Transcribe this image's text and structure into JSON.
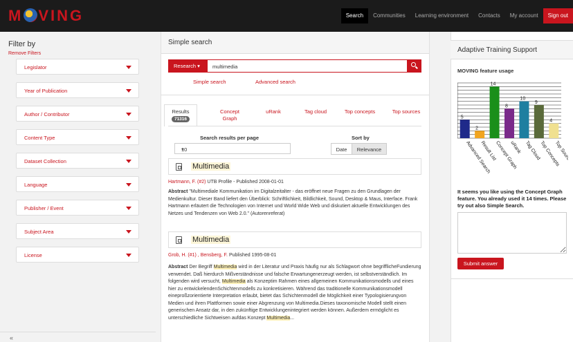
{
  "app": {
    "logo_text_left": "M",
    "logo_text_right": "VING"
  },
  "nav": {
    "items": [
      "Search",
      "Communities",
      "Learning environment",
      "Contacts",
      "My account"
    ],
    "signout": "Sign out"
  },
  "sidebar": {
    "title": "Filter by",
    "remove": "Remove Filters",
    "filters": [
      "Legislator",
      "Year of Publication",
      "Author / Contributor",
      "Content Type",
      "Dataset Collection",
      "Language",
      "Publisher / Event",
      "Subject Area",
      "License"
    ]
  },
  "search": {
    "header": "Simple search",
    "mode": "Research ▾",
    "query": "multimedia",
    "simple_link": "Simple search",
    "advanced_link": "Advanced search"
  },
  "tabs": {
    "results": "Results",
    "results_count": "71316",
    "concept_1": "Concept",
    "concept_2": "Graph",
    "urank": "uRank",
    "tagcloud": "Tag cloud",
    "topconcepts": "Top concepts",
    "topsources": "Top sources"
  },
  "controls": {
    "per_page_label": "Search results per page",
    "per_page_value": "10",
    "sort_label": "Sort by",
    "sort_date": "Date",
    "sort_relevance": "Relevance"
  },
  "results": [
    {
      "title": "Multimedia",
      "author": "Hartmann, F. (#2)",
      "meta": " UTB Profile - Published 2008-01-01",
      "abstract_label": "Abstract",
      "abstract": "\"Multimediale Kommunikation im Digitalzeitalter - das eröffnet neue Fragen zu den Grundlagen der Medienkultur. Dieser Band liefert den Überblick: Schriftlichkeit, Bildlichkeit, Sound, Desktop & Maus, Interface. Frank Hartmann erläutert die Technologien von Internet und World Wide Web und diskutiert aktuelle Entwicklungen des Netzes und Tendenzen von Web 2.0.\" (Autorenreferat)"
    },
    {
      "title": "Multimedia",
      "author": "Grob, H. (#1)",
      "author2": " , Bensberg, F.",
      "meta": " Published 1995-08-01",
      "abstract_label": "Abstract",
      "abstract_a": " Der Begriff ",
      "hl1": "Multimedia",
      "abstract_b": " wird in der Literatur und Praxis häufig nur als Schlagwort ohne begrifflicheFundierung verwendet. Daß hierdurch Mißverständnisse und falsche Erwartungenerzeugt werden, ist selbstverständlich. Im folgenden wird versucht, ",
      "hl2": "Multimedia",
      "abstract_c": " als Konzeptim Rahmen eines allgemeinen Kommunikationsmodells und eines hier zu entwickelendenSchichtenmodells zu konkretisieren. Während das traditionelle Kommunikationsmodell eineproßzorientierte Interpretation erlaubt, bietet das Schichtenmodell die Möglichkeit einer Typologisierungvon Medien und ihren Plattformen sowie einer Abgrenzung von Multimedia.Dieses taxonomische Modell stellt einen generischen Ansatz dar, in den zukünftige Entwicklungenintegriert werden können. Außerdem ermöglicht es unterschiedliche Sichtweisen aufdas Konzept ",
      "hl3": "Multimedia",
      "abstract_d": "..."
    }
  ],
  "ats": {
    "header": "Adaptive Training Support",
    "chart_title": "MOVING feature usage",
    "hint": "It seems you like using the Concept Graph feature. You already used it 14 times. Please try out also Simple Search.",
    "submit": "Submit answer"
  },
  "chart_data": {
    "type": "bar",
    "title": "MOVING feature usage",
    "categories": [
      "Advanced Search",
      "Result List",
      "Concept Graph",
      "uRank",
      "Tag Cloud",
      "Top Concepts",
      "Top Sources"
    ],
    "values": [
      5,
      2,
      14,
      8,
      10,
      9,
      4
    ],
    "colors": [
      "#1f2a8a",
      "#f2a51f",
      "#1a8f1a",
      "#7a2a8a",
      "#1e7fa0",
      "#5a6a3a",
      "#f0e090"
    ],
    "ylim": [
      0,
      15
    ],
    "grid": true
  }
}
